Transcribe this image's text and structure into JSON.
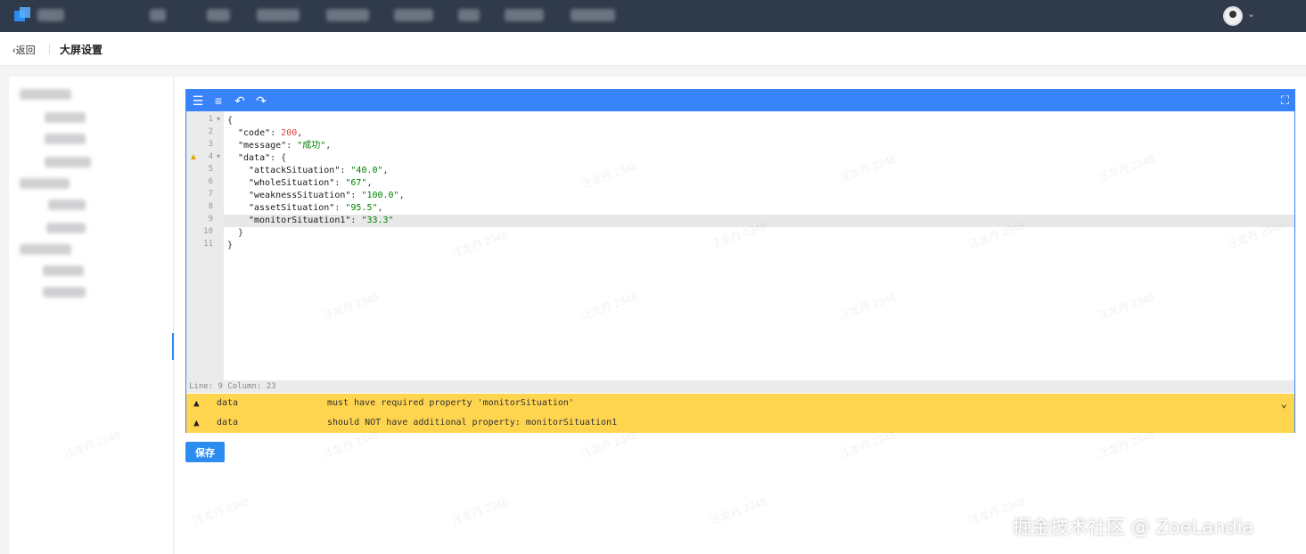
{
  "header": {
    "back_label": "返回",
    "page_title": "大屏设置"
  },
  "editor": {
    "toolbar_icons": [
      "format-icon",
      "compact-icon",
      "undo-icon",
      "redo-icon",
      "fullscreen-icon"
    ],
    "code_lines": [
      {
        "ln": "1",
        "text": "{"
      },
      {
        "ln": "2",
        "key": "\"code\"",
        "value": "200",
        "type": "number",
        "suffix": ","
      },
      {
        "ln": "3",
        "key": "\"message\"",
        "value": "\"成功\"",
        "type": "string",
        "suffix": ","
      },
      {
        "ln": "4",
        "key": "\"data\"",
        "open": "{"
      },
      {
        "ln": "5",
        "key": "\"attackSituation\"",
        "value": "\"40.0\"",
        "type": "string",
        "suffix": ","
      },
      {
        "ln": "6",
        "key": "\"wholeSituation\"",
        "value": "\"67\"",
        "type": "string",
        "suffix": ","
      },
      {
        "ln": "7",
        "key": "\"weaknessSituation\"",
        "value": "\"100.0\"",
        "type": "string",
        "suffix": ","
      },
      {
        "ln": "8",
        "key": "\"assetSituation\"",
        "value": "\"95.5\"",
        "type": "string",
        "suffix": ","
      },
      {
        "ln": "9",
        "key": "\"monitorSituation1\"",
        "value": "\"33.3\"",
        "type": "string",
        "suffix": ""
      },
      {
        "ln": "10",
        "text": "}"
      },
      {
        "ln": "11",
        "text": "}"
      }
    ],
    "status": "Line: 9  Column: 23",
    "errors": [
      {
        "path": "data",
        "message": "must have required property 'monitorSituation'"
      },
      {
        "path": "data",
        "message": "should NOT have additional property: monitorSituation1"
      }
    ]
  },
  "save_label": "保存",
  "watermark": "汪龙丹 2348",
  "credit": "掘金技术社区 @ ZoeLandia"
}
